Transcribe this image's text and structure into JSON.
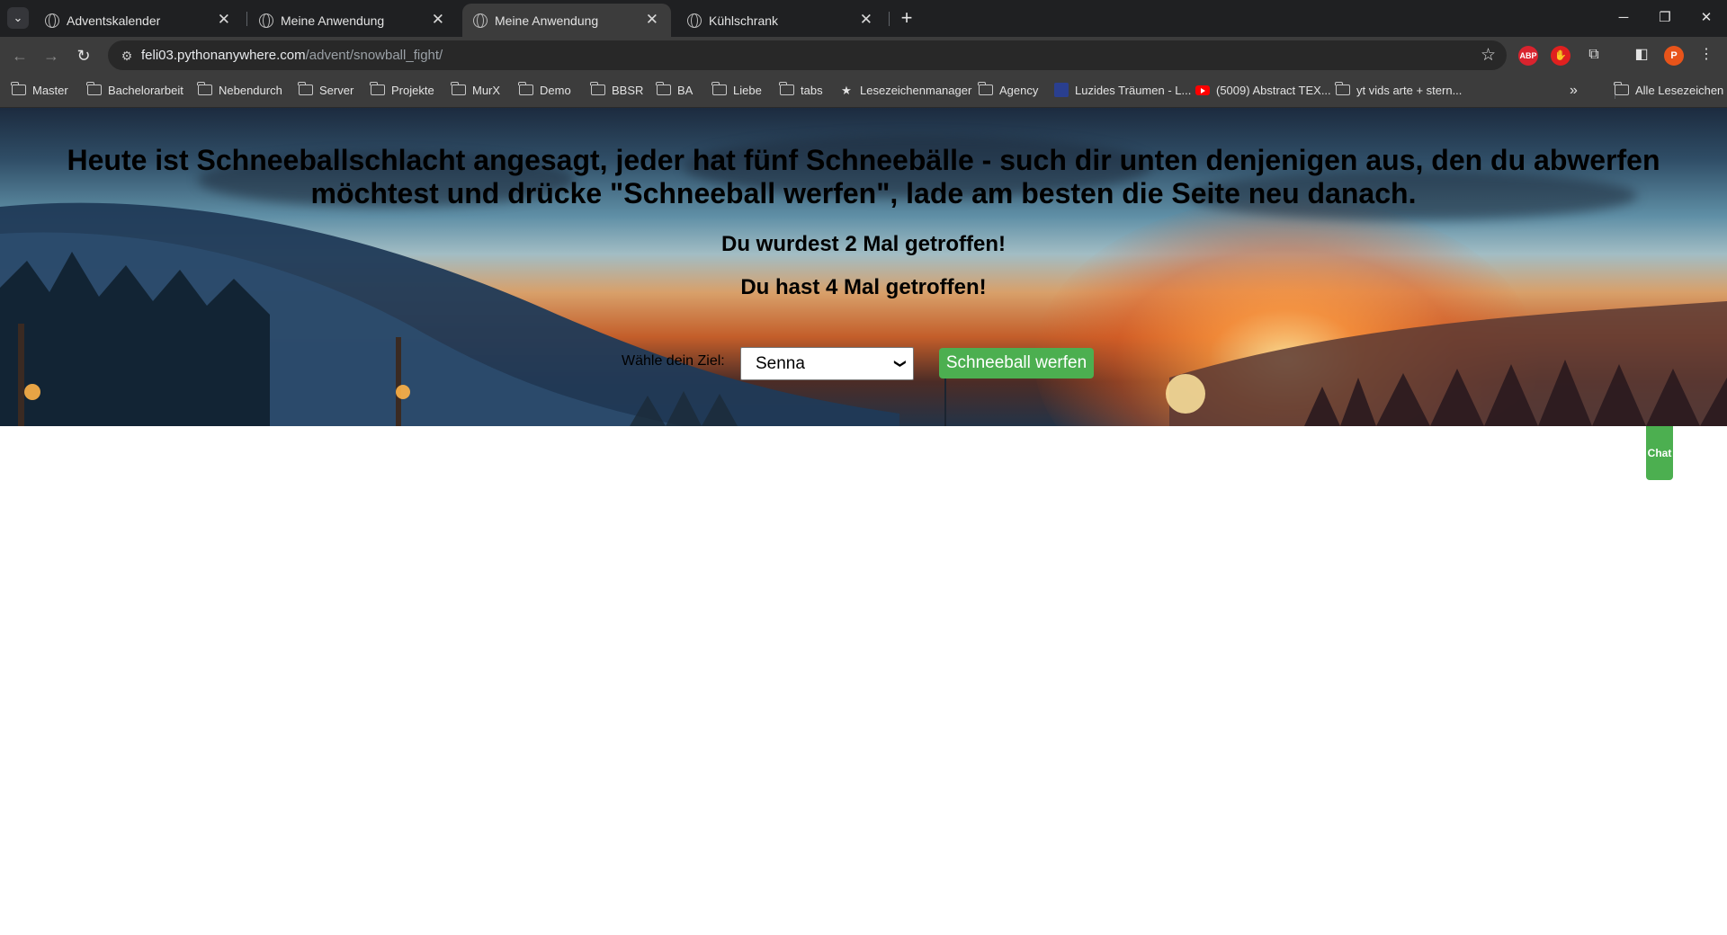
{
  "browser": {
    "tabs": [
      {
        "title": "Adventskalender",
        "active": false
      },
      {
        "title": "Meine Anwendung",
        "active": false
      },
      {
        "title": "Meine Anwendung",
        "active": true
      },
      {
        "title": "Kühlschrank",
        "active": false
      }
    ],
    "url_host": "feli03.pythonanywhere.com",
    "url_path": "/advent/snowball_fight/",
    "profile_initial": "P",
    "extensions": [
      {
        "name": "adblock-plus",
        "label": "ABP",
        "color": "#d9232e"
      },
      {
        "name": "hand-extension",
        "label": "✋",
        "color": "#e0201f"
      }
    ],
    "bookmarks": [
      {
        "label": "Master",
        "icon": "folder-icon"
      },
      {
        "label": "Bachelorarbeit",
        "icon": "folder-icon"
      },
      {
        "label": "Nebendurch",
        "icon": "folder-icon"
      },
      {
        "label": "Server",
        "icon": "folder-icon"
      },
      {
        "label": "Projekte",
        "icon": "folder-icon"
      },
      {
        "label": "MurX",
        "icon": "folder-icon"
      },
      {
        "label": "Demo",
        "icon": "folder-icon"
      },
      {
        "label": "BBSR",
        "icon": "folder-icon"
      },
      {
        "label": "BA",
        "icon": "folder-icon"
      },
      {
        "label": "Liebe",
        "icon": "folder-icon"
      },
      {
        "label": "tabs",
        "icon": "folder-icon"
      },
      {
        "label": "Lesezeichenmanager",
        "icon": "star-icon"
      },
      {
        "label": "Agency",
        "icon": "folder-icon"
      },
      {
        "label": "Luzides Träumen - L...",
        "icon": "site-icon"
      },
      {
        "label": "(5009) Abstract TEX...",
        "icon": "youtube-icon"
      },
      {
        "label": "yt vids arte + stern...",
        "icon": "folder-icon"
      }
    ],
    "all_bookmarks_label": "Alle Lesezeichen"
  },
  "page": {
    "headline": "Heute ist Schneeballschlacht angesagt, jeder hat fünf Schneebälle - such dir unten denjenigen aus, den du abwerfen möchtest und drücke \"Schneeball werfen\", lade am besten die Seite neu danach.",
    "hit_received": "Du wurdest 2 Mal getroffen!",
    "hit_given": "Du hast 4 Mal getroffen!",
    "target_label": "Wähle dein Ziel:",
    "target_selected": "Senna",
    "throw_button": "Schneeball werfen",
    "chat_button": "Chat",
    "colors": {
      "button_green": "#4caf50"
    }
  }
}
